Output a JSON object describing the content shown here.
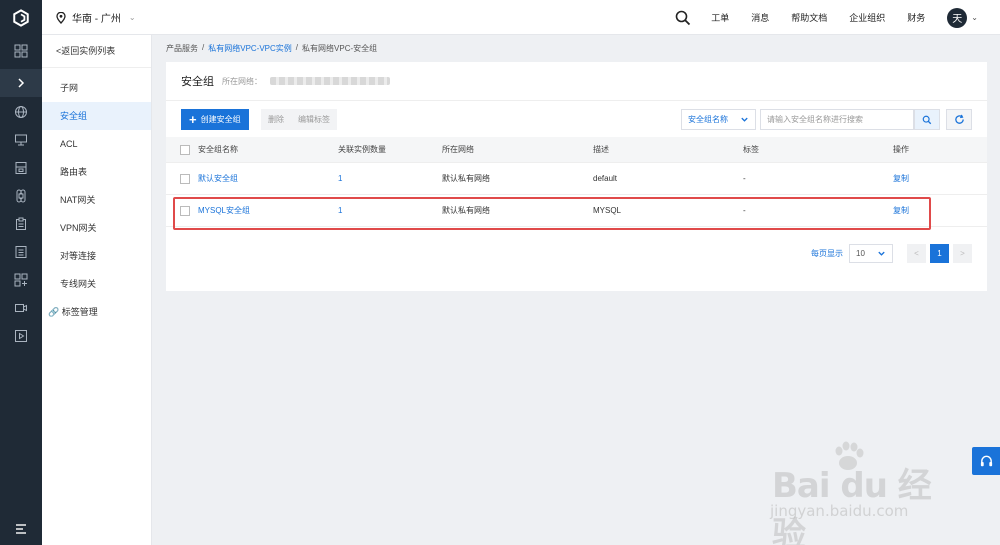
{
  "topbar": {
    "region": "华南 - 广州",
    "nav": [
      "工单",
      "消息",
      "帮助文档",
      "企业组织",
      "财务"
    ],
    "avatar_initial": "天"
  },
  "sidebar": {
    "back": "<返回实例列表",
    "items": [
      "子网",
      "安全组",
      "ACL",
      "路由表",
      "NAT网关",
      "VPN网关",
      "对等连接",
      "专线网关"
    ],
    "tag_item": "标签管理"
  },
  "breadcrumb": {
    "root": "产品服务",
    "sep": "/",
    "mid": "私有网络VPC-VPC实例",
    "current": "私有网络VPC-安全组"
  },
  "card": {
    "title": "安全组",
    "network_label": "所在网络："
  },
  "toolbar": {
    "create": "创建安全组",
    "delete": "删除",
    "edit_tags": "编辑标签",
    "select_value": "安全组名称",
    "search_placeholder": "请输入安全组名称进行搜索"
  },
  "table": {
    "headers": [
      "安全组名称",
      "关联实例数量",
      "所在网络",
      "描述",
      "标签",
      "操作"
    ],
    "rows": [
      {
        "name": "默认安全组",
        "count": "1",
        "network": "默认私有网络",
        "desc": "default",
        "tag": "-",
        "action": "复制"
      },
      {
        "name": "MYSQL安全组",
        "count": "1",
        "network": "默认私有网络",
        "desc": "MYSQL",
        "tag": "-",
        "action": "复制"
      }
    ]
  },
  "pager": {
    "label": "每页显示",
    "size": "10",
    "prev": "<",
    "current": "1",
    "next": ">"
  },
  "watermark": {
    "text": "Bai du 经验",
    "sub": "jingyan.baidu.com"
  },
  "colors": {
    "accent": "#1a73d9",
    "rail": "#1f2a36",
    "highlight": "#e04a4a"
  }
}
